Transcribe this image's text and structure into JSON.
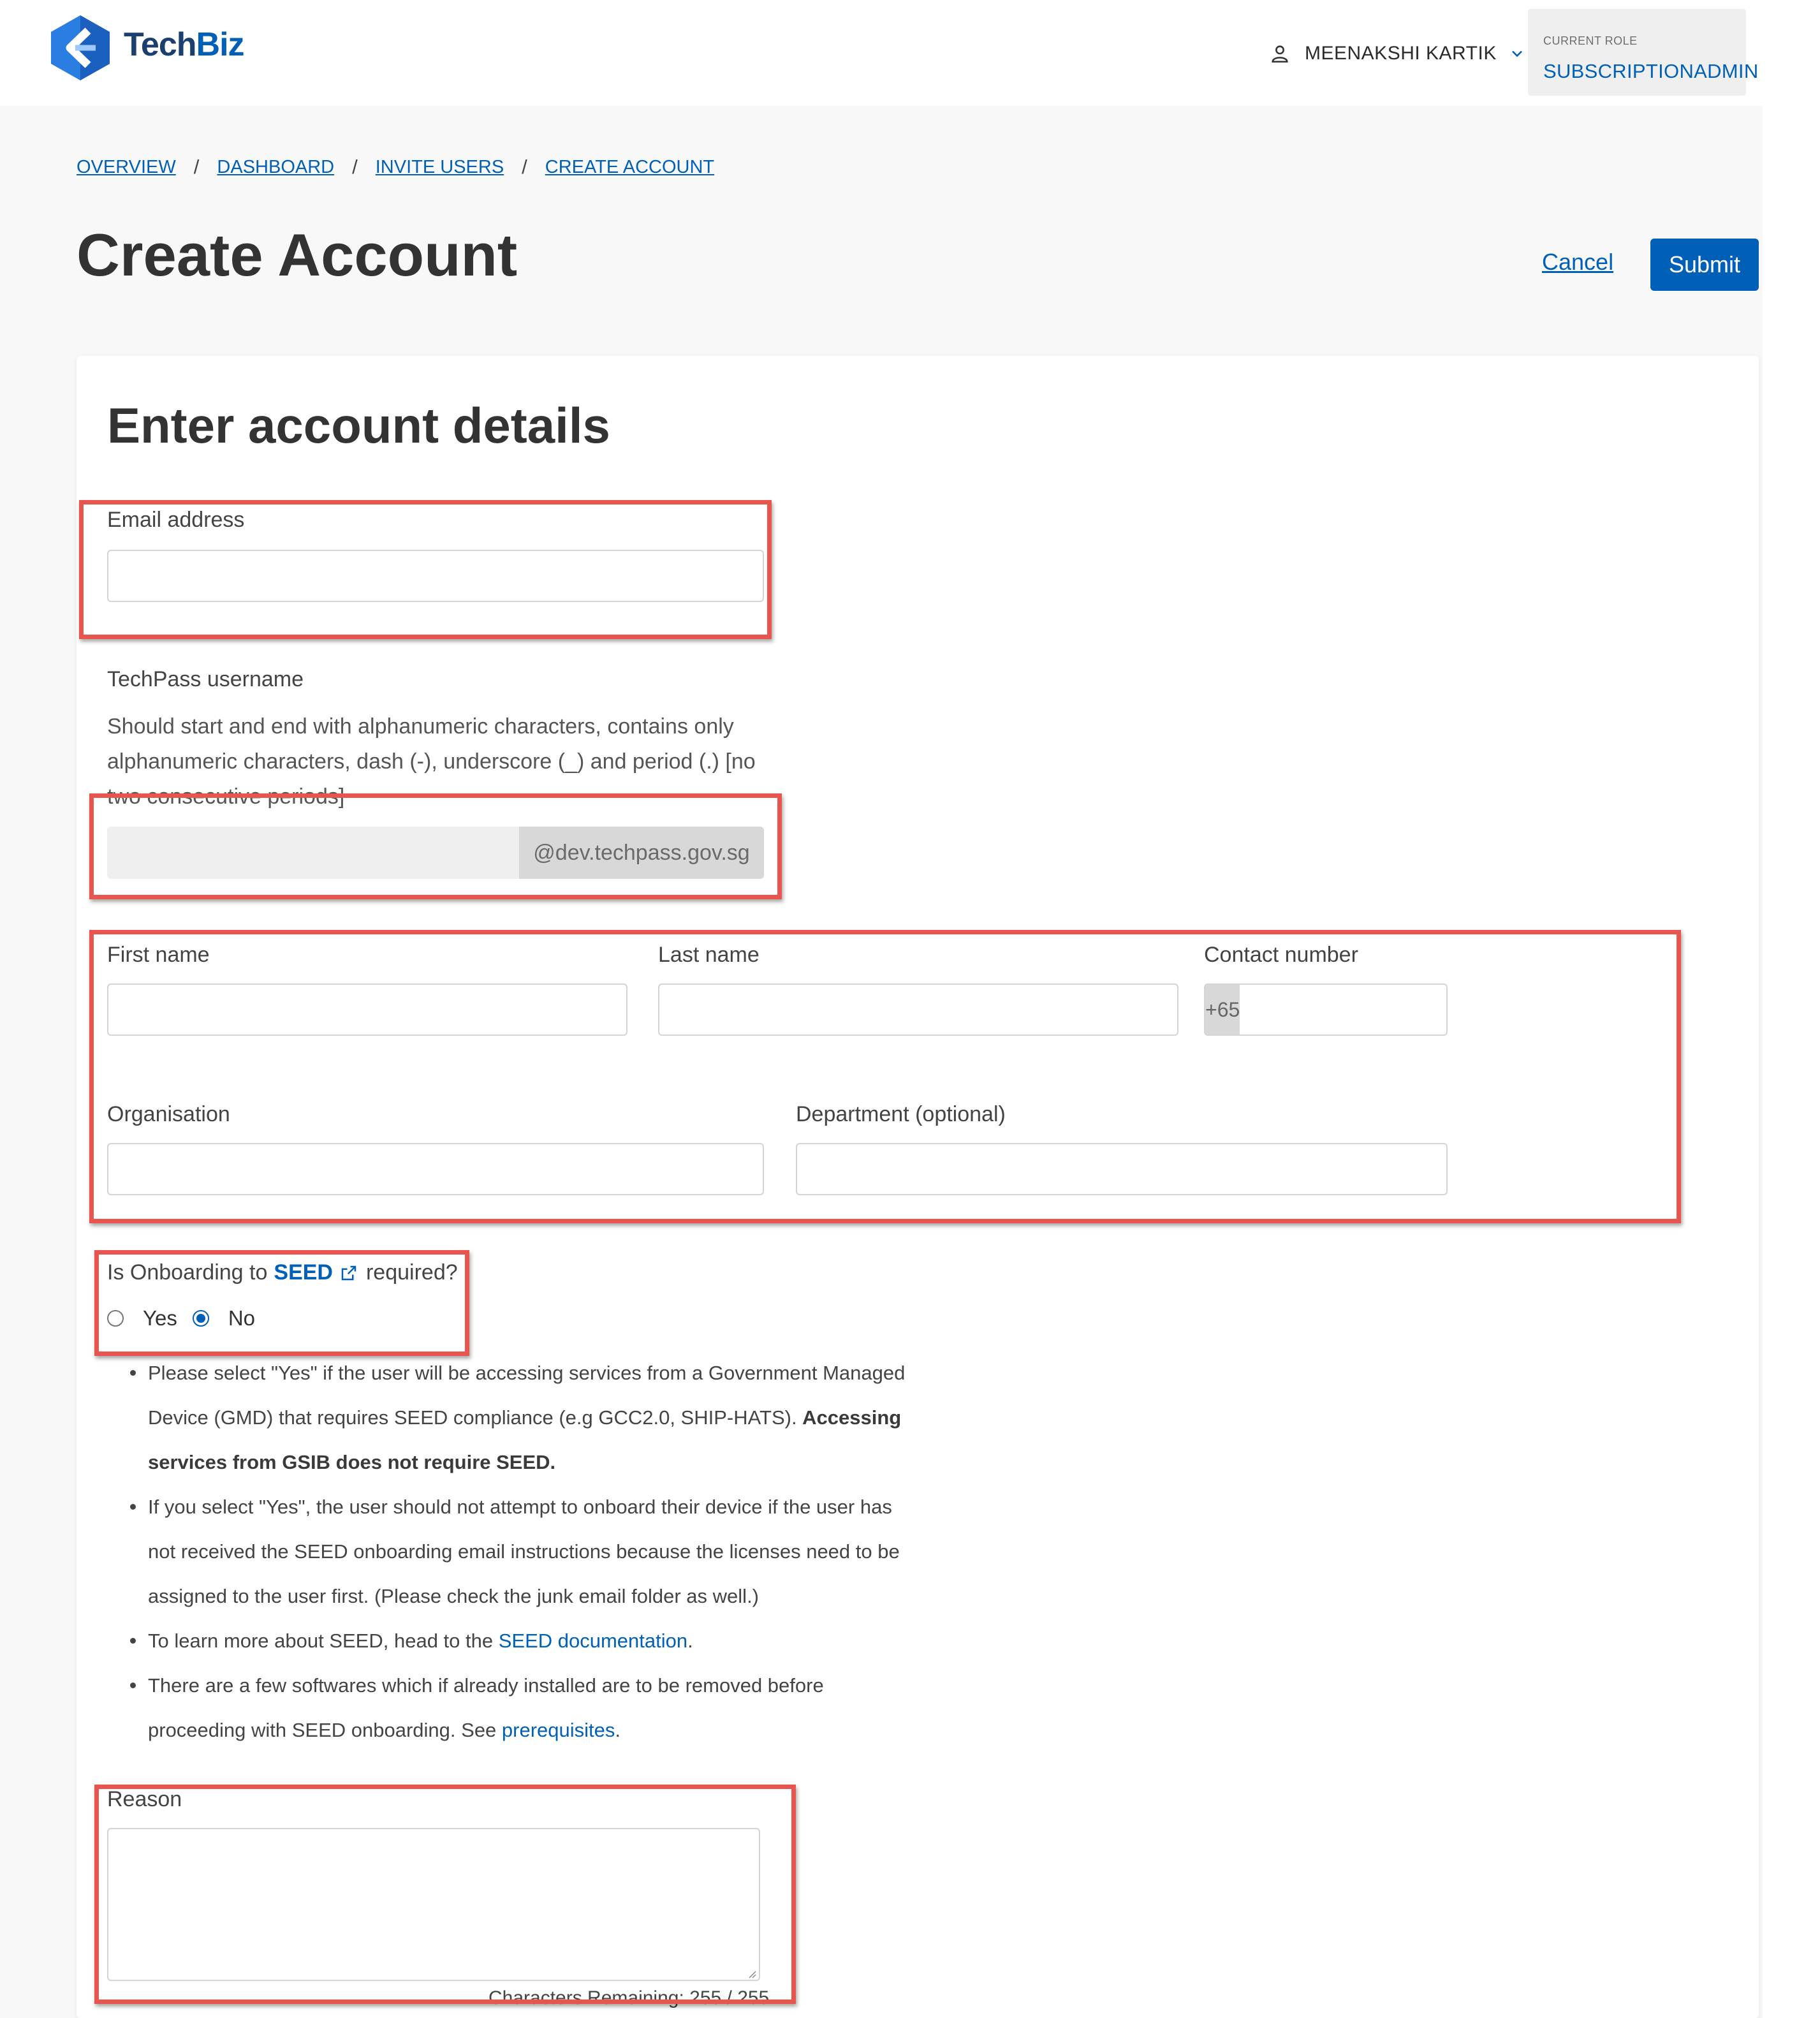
{
  "header": {
    "logo": {
      "tech": "Tech",
      "biz": "Biz"
    },
    "user_name": "MEENAKSHI KARTIK",
    "role_label": "CURRENT ROLE",
    "role_value": "SUBSCRIPTIONADMIN"
  },
  "breadcrumb": [
    "OVERVIEW",
    "DASHBOARD",
    "INVITE USERS",
    "CREATE ACCOUNT"
  ],
  "breadcrumb_separator": "/",
  "page_title": "Create Account",
  "actions": {
    "cancel": "Cancel",
    "submit": "Submit"
  },
  "form": {
    "section_title": "Enter account details",
    "email": {
      "label": "Email address",
      "value": "",
      "placeholder": ""
    },
    "techpass": {
      "label": "TechPass username",
      "hint": "Should start and end with alphanumeric characters, contains only alphanumeric characters, dash (-), underscore (_) and period (.) [no two consecutive periods]",
      "value": "",
      "suffix": "@dev.techpass.gov.sg"
    },
    "first_name": {
      "label": "First name",
      "value": ""
    },
    "last_name": {
      "label": "Last name",
      "value": ""
    },
    "contact": {
      "label": "Contact number",
      "prefix": "+65",
      "value": ""
    },
    "organisation": {
      "label": "Organisation",
      "value": ""
    },
    "department": {
      "label": "Department (optional)",
      "value": ""
    },
    "seed": {
      "question_prefix": "Is Onboarding to",
      "link": "SEED",
      "question_suffix": "required?",
      "options": [
        "Yes",
        "No"
      ],
      "selected": "No",
      "bullets": {
        "b1_text": "Please select \"Yes\" if the user will be accessing services from a Government Managed Device (GMD) that requires SEED compliance (e.g GCC2.0, SHIP-HATS). ",
        "b1_bold": "Accessing services from GSIB does not require SEED.",
        "b2_text": "If you select \"Yes\", the user should not attempt to onboard their device if the user has not received the SEED onboarding email instructions because the licenses need to be assigned to the user first. (Please check the junk email folder as well.)",
        "b3_prefix": "To learn more about SEED, head to the ",
        "b3_link": "SEED documentation",
        "b3_suffix": ".",
        "b4_prefix": "There are a few softwares which if already installed are to be removed before proceeding with SEED onboarding. See ",
        "b4_link": "prerequisites",
        "b4_suffix": "."
      }
    },
    "reason": {
      "label": "Reason",
      "value": "",
      "remaining": "Characters Remaining: 255 / 255"
    }
  },
  "colors": {
    "brand_blue": "#0060b8",
    "annotation_red": "#e8554e",
    "background": "#f8f8f8"
  }
}
